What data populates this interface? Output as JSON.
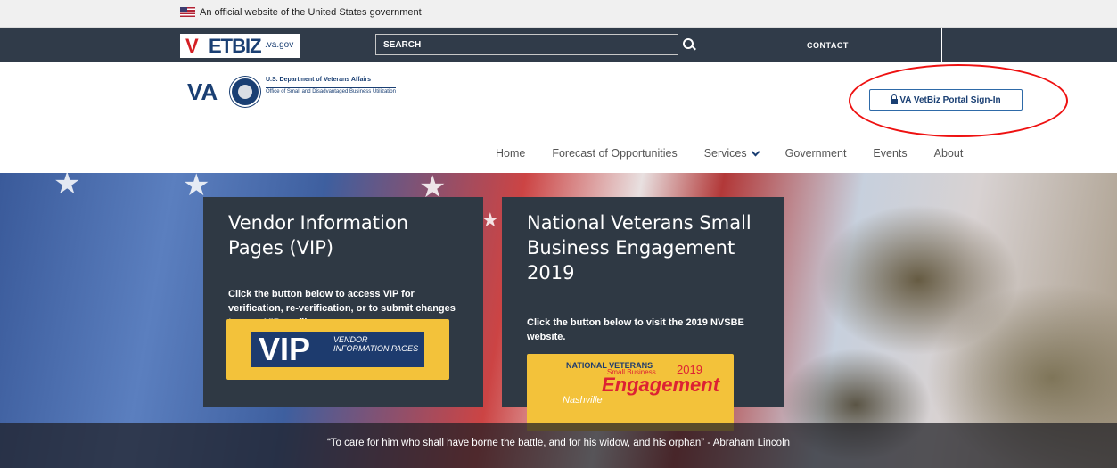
{
  "gov_banner": {
    "text": "An official website of the United States government"
  },
  "topbar": {
    "logo": {
      "brand": "VETBIZ",
      "v": "V",
      "biz": "ETBIZ",
      "domain": ".va.gov"
    },
    "search": {
      "placeholder": "SEARCH"
    },
    "contact_label": "CONTACT"
  },
  "va_header": {
    "letters": "VA",
    "dept": "U.S. Department of Veterans Affairs",
    "office": "Office of Small and Disadvantaged Business Utilization"
  },
  "portal_button": {
    "label": "VA VetBiz Portal Sign-In"
  },
  "nav": {
    "items": [
      {
        "label": "Home"
      },
      {
        "label": "Forecast of Opportunities"
      },
      {
        "label": "Services"
      },
      {
        "label": "Government"
      },
      {
        "label": "Events"
      },
      {
        "label": "About"
      }
    ]
  },
  "vip_panel": {
    "title": "Vendor Information Pages (VIP)",
    "description": "Click the button below to access VIP for verification, re-verification, or to submit changes to your VIP profile.",
    "badge_big": "VIP",
    "badge_small": "VENDOR INFORMATION PAGES"
  },
  "nvsbe_panel": {
    "title": "National Veterans Small Business Engagement 2019",
    "description": "Click the button below to visit the 2019 NVSBE website.",
    "logo_top": "NATIONAL VETERANS",
    "logo_small": "Small Business",
    "logo_year": "2019",
    "logo_engagement": "Engagement",
    "logo_city": "Nashville"
  },
  "quote": {
    "text": "“To care for him who shall have borne the battle, and for his widow, and his orphan” - Abraham Lincoln"
  }
}
